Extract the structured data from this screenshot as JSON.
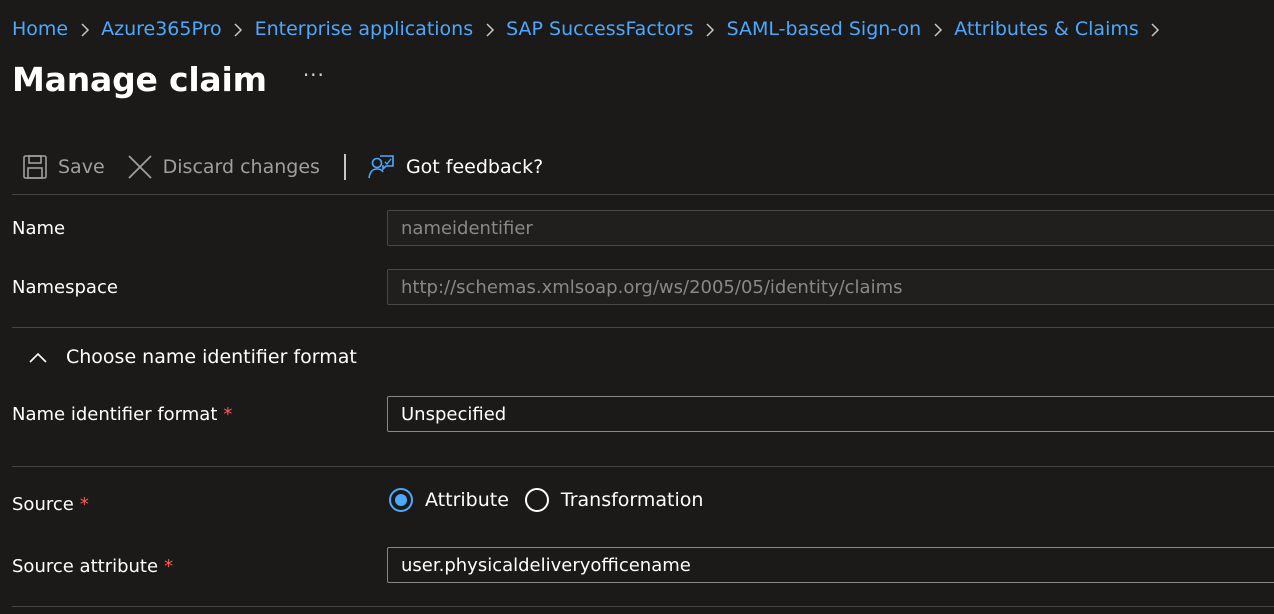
{
  "breadcrumb": [
    {
      "label": "Home"
    },
    {
      "label": "Azure365Pro"
    },
    {
      "label": "Enterprise applications"
    },
    {
      "label": "SAP SuccessFactors"
    },
    {
      "label": "SAML-based Sign-on"
    },
    {
      "label": "Attributes & Claims"
    }
  ],
  "page": {
    "title": "Manage claim",
    "more_label": "···"
  },
  "toolbar": {
    "save_label": "Save",
    "discard_label": "Discard changes",
    "feedback_label": "Got feedback?"
  },
  "form": {
    "name": {
      "label": "Name",
      "value": "nameidentifier"
    },
    "namespace": {
      "label": "Namespace",
      "value": "http://schemas.xmlsoap.org/ws/2005/05/identity/claims"
    },
    "section": {
      "label": "Choose name identifier format",
      "expanded": true
    },
    "name_id_format": {
      "label": "Name identifier format",
      "required_mark": "*",
      "value": "Unspecified"
    },
    "source": {
      "label": "Source",
      "required_mark": "*",
      "options": [
        {
          "label": "Attribute",
          "selected": true
        },
        {
          "label": "Transformation",
          "selected": false
        }
      ]
    },
    "source_attribute": {
      "label": "Source attribute",
      "required_mark": "*",
      "value": "user.physicaldeliveryofficename"
    }
  },
  "colors": {
    "accent": "#4ca8ff",
    "background": "#1b1a19",
    "required": "#ff5b5b"
  },
  "icons": [
    "chevron-right-icon",
    "save-icon",
    "close-icon",
    "feedback-icon",
    "chevron-up-icon"
  ]
}
